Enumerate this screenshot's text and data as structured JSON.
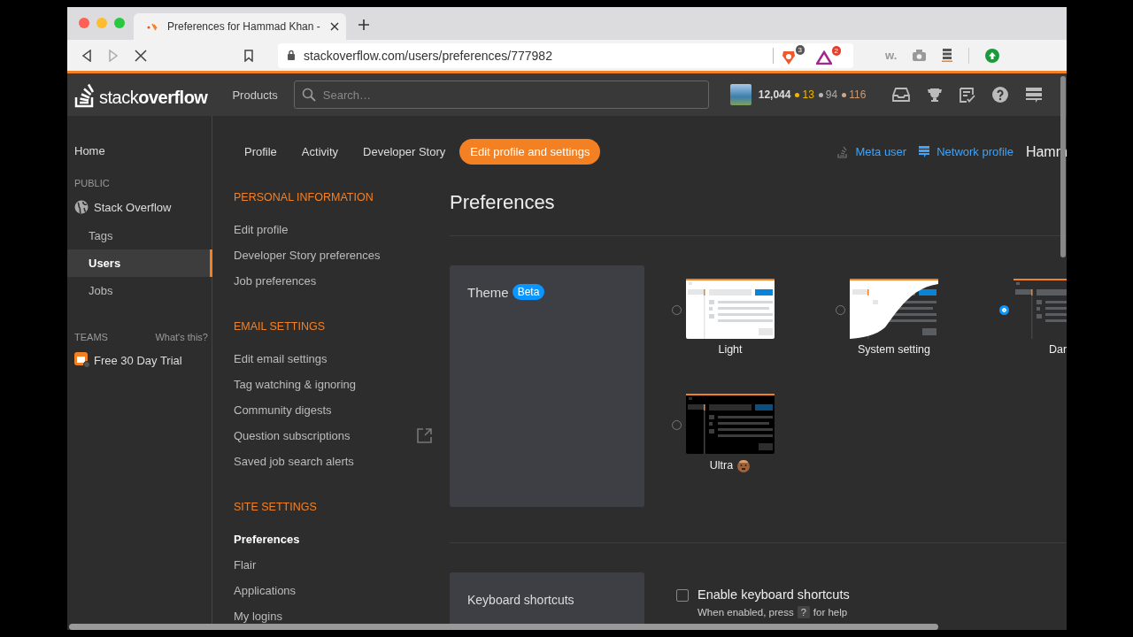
{
  "browser": {
    "tab_title": "Preferences for Hammad Khan -",
    "url": "stackoverflow.com/users/preferences/777982",
    "shield_count": "3",
    "rewards_count": "2",
    "ext_w": "w."
  },
  "header": {
    "logo": "stack**overflow**",
    "products": "Products",
    "search_placeholder": "Search…",
    "reputation": "12,044",
    "gold": "13",
    "silver": "94",
    "bronze": "116"
  },
  "sidebar": {
    "home": "Home",
    "public_label": "PUBLIC",
    "site": "Stack Overflow",
    "items": [
      {
        "label": "Tags",
        "selected": false
      },
      {
        "label": "Users",
        "selected": true
      },
      {
        "label": "Jobs",
        "selected": false
      }
    ],
    "teams_label": "TEAMS",
    "teams_link": "What's this?",
    "trial": "Free 30 Day Trial"
  },
  "nav": {
    "tabs": [
      {
        "label": "Profile",
        "selected": false
      },
      {
        "label": "Activity",
        "selected": false
      },
      {
        "label": "Developer Story",
        "selected": false
      },
      {
        "label": "Edit profile and settings",
        "selected": true
      }
    ],
    "meta_user": "Meta user",
    "network_profile": "Network profile",
    "user_name": "Hamm"
  },
  "settings_nav": [
    {
      "heading": "PERSONAL INFORMATION",
      "items": [
        {
          "label": "Edit profile",
          "selected": false,
          "external": false
        },
        {
          "label": "Developer Story preferences",
          "selected": false,
          "external": false
        },
        {
          "label": "Job preferences",
          "selected": false,
          "external": false
        }
      ]
    },
    {
      "heading": "EMAIL SETTINGS",
      "items": [
        {
          "label": "Edit email settings",
          "selected": false,
          "external": false
        },
        {
          "label": "Tag watching & ignoring",
          "selected": false,
          "external": false
        },
        {
          "label": "Community digests",
          "selected": false,
          "external": false
        },
        {
          "label": "Question subscriptions",
          "selected": false,
          "external": true
        },
        {
          "label": "Saved job search alerts",
          "selected": false,
          "external": false
        }
      ]
    },
    {
      "heading": "SITE SETTINGS",
      "items": [
        {
          "label": "Preferences",
          "selected": true,
          "external": false
        },
        {
          "label": "Flair",
          "selected": false,
          "external": false
        },
        {
          "label": "Applications",
          "selected": false,
          "external": false
        },
        {
          "label": "My logins",
          "selected": false,
          "external": false
        }
      ]
    }
  ],
  "page_title": "Preferences",
  "theme": {
    "label": "Theme",
    "badge": "Beta",
    "options": [
      {
        "label": "Light",
        "kind": "light",
        "selected": false
      },
      {
        "label": "System setting",
        "kind": "system",
        "selected": false
      },
      {
        "label": "Dar",
        "kind": "dark",
        "selected": true
      },
      {
        "label": "Ultra",
        "kind": "ultra",
        "selected": false
      }
    ]
  },
  "keyboard": {
    "title": "Keyboard shortcuts",
    "label": "Enable keyboard shortcuts",
    "checked": false,
    "hint_before": "When enabled, press",
    "key": "?",
    "hint_after": "for help"
  }
}
